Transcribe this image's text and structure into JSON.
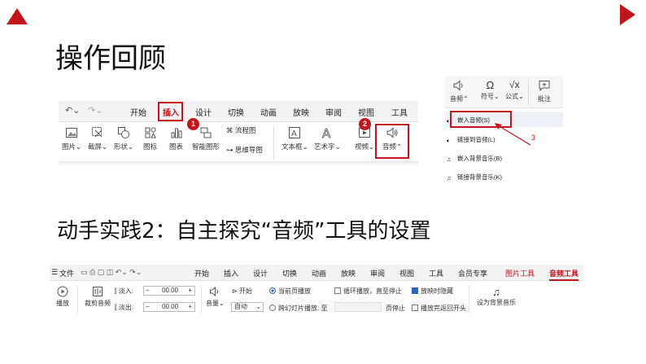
{
  "slide": {
    "title": "操作回顾",
    "subtitle": "动手实践2：自主探究“音频”工具的设置",
    "accent_color": "#c0161c"
  },
  "ribbon1": {
    "tabs": [
      "开始",
      "插入",
      "设计",
      "切换",
      "动画",
      "放映",
      "审阅",
      "视图",
      "工具"
    ],
    "active_tab": "插入",
    "tools": [
      "图片",
      "截屏",
      "形状",
      "图标",
      "图表",
      "智能图形",
      "流程图",
      "思维导图",
      "文本框",
      "艺术字",
      "视频",
      "音频"
    ],
    "badge1": "1",
    "badge2": "2"
  },
  "panel": {
    "top_tools": [
      "音频",
      "符号",
      "公式",
      "批注"
    ],
    "items": [
      "嵌入音频(S)",
      "链接到音频(L)",
      "嵌入背景音乐(B)",
      "链接背景音乐(K)"
    ],
    "step_number": "3"
  },
  "ribbon2": {
    "file_label": "文件",
    "tabs": [
      "开始",
      "插入",
      "设计",
      "切换",
      "动画",
      "放映",
      "审阅",
      "视图",
      "工具",
      "会员专享",
      "图片工具",
      "音频工具"
    ],
    "active_tab": "音频工具",
    "play_label": "播放",
    "trim_label": "裁剪音频",
    "fade_in_label": "淡入:",
    "fade_out_label": "淡出:",
    "fade_in_value": "00.00",
    "fade_out_value": "00.00",
    "volume_label": "音量",
    "start_label": "开始",
    "start_value": "自动",
    "radio_current": "当前页播放",
    "radio_across": "跨幻灯片播放: 至",
    "page_stop": "页停止",
    "loop_label": "循环播放，直至停止",
    "hide_label": "放映时隐藏",
    "rewind_label": "播放完返回开头",
    "bg_music_label": "设为背景音乐"
  }
}
